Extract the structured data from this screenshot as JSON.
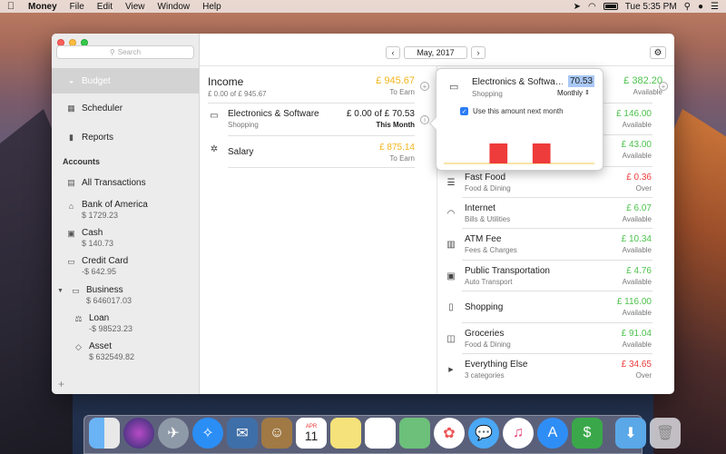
{
  "menubar": {
    "app_name": "Money",
    "menus": [
      "File",
      "Edit",
      "View",
      "Window",
      "Help"
    ],
    "clock": "Tue 5:35 PM"
  },
  "sidebar": {
    "search_placeholder": "Search",
    "nav": [
      {
        "label": "Budget",
        "icon": "budget-icon"
      },
      {
        "label": "Scheduler",
        "icon": "calendar-icon"
      },
      {
        "label": "Reports",
        "icon": "bar-chart-icon"
      }
    ],
    "accounts_heading": "Accounts",
    "all_transactions": "All Transactions",
    "accounts": [
      {
        "name": "Bank of America",
        "balance": "$ 1729.23",
        "icon": "bank-icon"
      },
      {
        "name": "Cash",
        "balance": "$ 140.73",
        "icon": "cash-icon"
      },
      {
        "name": "Credit Card",
        "balance": "-$ 642.95",
        "icon": "credit-card-icon"
      },
      {
        "name": "Business",
        "balance": "$ 646017.03",
        "icon": "folder-icon"
      },
      {
        "name": "Loan",
        "balance": "-$ 98523.23",
        "icon": "loan-icon"
      },
      {
        "name": "Asset",
        "balance": "$ 632549.82",
        "icon": "diamond-icon"
      }
    ]
  },
  "toolbar": {
    "month": "May, 2017",
    "prev": "‹",
    "next": "›",
    "gear": "⚙"
  },
  "income": {
    "title": "Income",
    "subtitle": "£ 0.00 of £ 945.67",
    "amount": "£ 945.67",
    "amount_sub": "To Earn",
    "rows": [
      {
        "title": "Electronics & Software",
        "sub": "Shopping",
        "amount": "£ 0.00 of £ 70.53",
        "amount_sub": "This Month"
      },
      {
        "title": "Salary",
        "sub": "",
        "amount": "£ 875.14",
        "amount_sub": "To Earn"
      }
    ]
  },
  "popover": {
    "title": "Electronics & Softwa…",
    "value": "70.53",
    "category": "Shopping",
    "period": "Monthly",
    "checkbox_label": "Use this amount next month",
    "checked": true,
    "bars": [
      0,
      0,
      1,
      0,
      1,
      0,
      0
    ]
  },
  "expenses": {
    "top_amount": "£ 382.20",
    "top_sub": "Available",
    "partial_rows": [
      {
        "amount": "£ 146.00",
        "sub": "Available"
      },
      {
        "amount": "£ 43.00",
        "sub": "Available"
      }
    ],
    "rows": [
      {
        "title": "Fast Food",
        "sub": "Food & Dining",
        "amount": "£ 0.36",
        "amount_sub": "Over",
        "color": "red",
        "icon": "burger-icon"
      },
      {
        "title": "Internet",
        "sub": "Bills & Utilities",
        "amount": "£ 6.07",
        "amount_sub": "Available",
        "color": "green",
        "icon": "wifi-icon"
      },
      {
        "title": "ATM Fee",
        "sub": "Fees & Charges",
        "amount": "£ 10.34",
        "amount_sub": "Available",
        "color": "green",
        "icon": "atm-icon"
      },
      {
        "title": "Public Transportation",
        "sub": "Auto Transport",
        "amount": "£ 4.76",
        "amount_sub": "Available",
        "color": "green",
        "icon": "train-icon"
      },
      {
        "title": "Shopping",
        "sub": "",
        "amount": "£ 116.00",
        "amount_sub": "Available",
        "color": "green",
        "icon": "clipboard-icon"
      },
      {
        "title": "Groceries",
        "sub": "Food & Dining",
        "amount": "£ 91.04",
        "amount_sub": "Available",
        "color": "green",
        "icon": "bag-icon"
      },
      {
        "title": "Everything Else",
        "sub": "3 categories",
        "amount": "£ 34.65",
        "amount_sub": "Over",
        "color": "red",
        "icon": "triangle-icon"
      }
    ]
  },
  "dock": {
    "apps": [
      "Finder",
      "Siri",
      "Launchpad",
      "Safari",
      "Mail",
      "Contacts",
      "Calendar",
      "Notes",
      "Reminders",
      "Maps",
      "Photos",
      "Messages",
      "iTunes",
      "App Store",
      "Money",
      "Downloads",
      "Trash"
    ],
    "calendar_day": "11",
    "calendar_month": "APR"
  },
  "colors": {
    "accent": "#4cc24c",
    "over": "#ec3b3b",
    "income": "#f2b51c",
    "selection": "#a9c8f5",
    "checkbox": "#2b7cf5"
  }
}
